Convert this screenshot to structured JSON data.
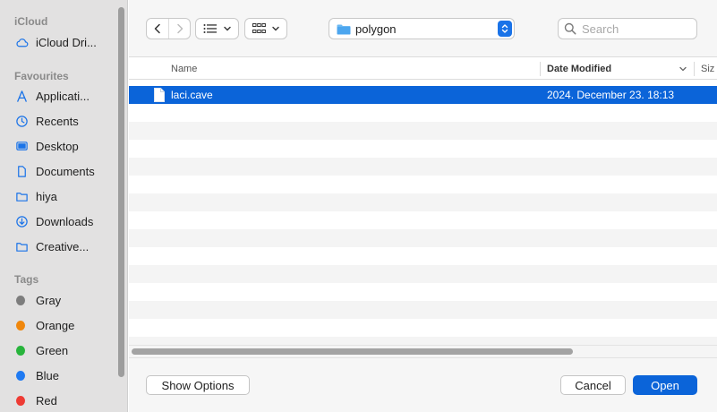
{
  "sidebar": {
    "sections": {
      "icloud": "iCloud",
      "favourites": "Favourites",
      "tags": "Tags"
    },
    "icloud_items": [
      {
        "label": "iCloud Dri...",
        "icon": "cloud-icon"
      }
    ],
    "favourites": [
      {
        "label": "Applicati...",
        "icon": "applications-icon"
      },
      {
        "label": "Recents",
        "icon": "clock-icon"
      },
      {
        "label": "Desktop",
        "icon": "desktop-icon"
      },
      {
        "label": "Documents",
        "icon": "document-icon"
      },
      {
        "label": "hiya",
        "icon": "folder-icon"
      },
      {
        "label": "Downloads",
        "icon": "download-icon"
      },
      {
        "label": "Creative...",
        "icon": "folder-icon"
      }
    ],
    "tags": [
      {
        "label": "Gray",
        "color": "#7d7d7d"
      },
      {
        "label": "Orange",
        "color": "#f0870c"
      },
      {
        "label": "Green",
        "color": "#28b43c"
      },
      {
        "label": "Blue",
        "color": "#1f7af2"
      },
      {
        "label": "Red",
        "color": "#ee3b34"
      }
    ]
  },
  "toolbar": {
    "location": "polygon",
    "search_placeholder": "Search"
  },
  "list": {
    "columns": {
      "name": "Name",
      "date_modified": "Date Modified",
      "size": "Siz"
    },
    "files": [
      {
        "name": "laci.cave",
        "date_modified": "2024. December 23. 18:13",
        "selected": true
      }
    ]
  },
  "footer": {
    "show_options": "Show Options",
    "cancel": "Cancel",
    "open": "Open"
  },
  "colors": {
    "accent": "#0b64d9",
    "sidebar_bg": "#e2e1e1"
  }
}
